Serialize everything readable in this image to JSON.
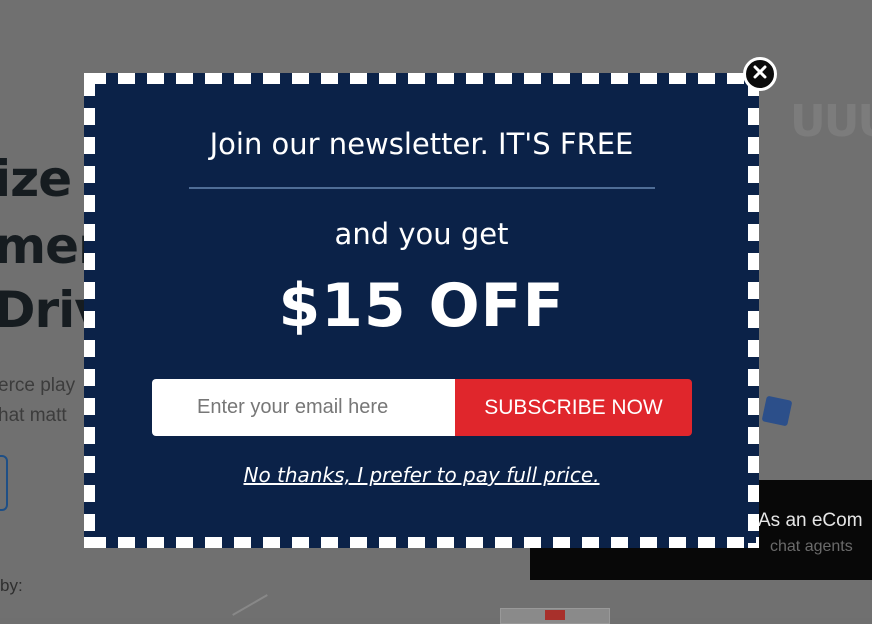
{
  "background": {
    "headline_lines": [
      "ize y",
      "mer",
      "Drive"
    ],
    "paragraph_lines": [
      "erce play",
      "hat matt"
    ],
    "trusted_by": "by:",
    "video_caption": "As an eCom",
    "video_caption_2": "chat agents"
  },
  "popup": {
    "title": "Join our newsletter. IT'S FREE",
    "subtitle": "and you get",
    "offer": "$15 OFF",
    "email_placeholder": "Enter your email here",
    "subscribe_label": "SUBSCRIBE NOW",
    "decline_label": "No thanks, I prefer to pay full price.",
    "close_icon": "close-icon",
    "colors": {
      "background": "#0b2248",
      "border_dash": "#ffffff",
      "button": "#e0262c",
      "divider": "#4f6d96"
    }
  }
}
